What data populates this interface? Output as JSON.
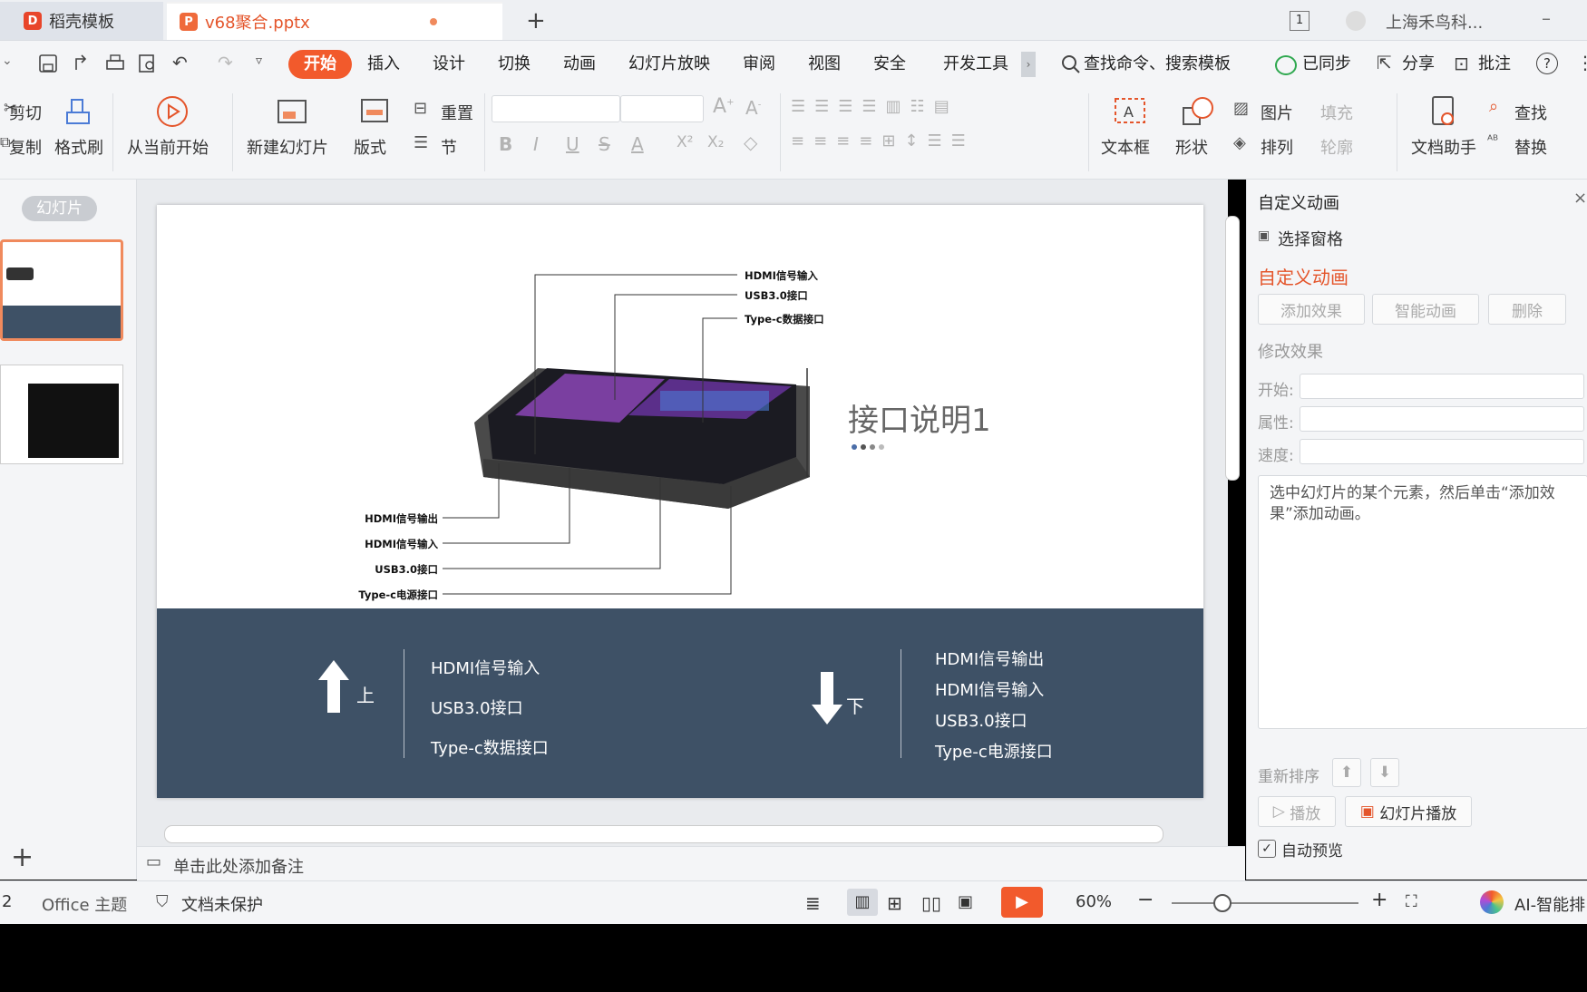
{
  "tabs": {
    "docer": "稻壳模板",
    "doc": "v68聚合.pptx",
    "page_count": "1",
    "account": "上海禾鸟科..."
  },
  "menu": {
    "start": "开始",
    "insert": "插入",
    "design": "设计",
    "transition": "切换",
    "animation": "动画",
    "slideshow": "幻灯片放映",
    "review": "审阅",
    "view": "视图",
    "security": "安全",
    "dev": "开发工具",
    "search": "查找命令、搜索模板",
    "synced": "已同步",
    "share": "分享",
    "annotate": "批注"
  },
  "ribbon": {
    "cut": "剪切",
    "copy": "复制",
    "format_painter": "格式刷",
    "from_current": "从当前开始",
    "new_slide": "新建幻灯片",
    "layout": "版式",
    "reset": "重置",
    "section": "节",
    "textbox": "文本框",
    "shape": "形状",
    "picture": "图片",
    "arrange": "排列",
    "fill": "填充",
    "outline": "轮廓",
    "doc_helper": "文档助手",
    "find": "查找",
    "replace": "替换"
  },
  "left": {
    "view_tab": "幻灯片"
  },
  "slide": {
    "title": "接口说明1",
    "callouts_top": [
      "HDMI信号输入",
      "USB3.0接口",
      "Type-c数据接口"
    ],
    "callouts_bottom": [
      "HDMI信号输出",
      "HDMI信号输入",
      "USB3.0接口",
      "Type-c电源接口"
    ],
    "up_label": "上",
    "down_label": "下",
    "up_items": [
      "HDMI信号输入",
      "USB3.0接口",
      "Type-c数据接口"
    ],
    "down_items": [
      "HDMI信号输出",
      "HDMI信号输入",
      "USB3.0接口",
      "Type-c电源接口"
    ]
  },
  "notes": "单击此处添加备注",
  "right": {
    "header": "自定义动画",
    "selection_pane": "选择窗格",
    "section_title": "自定义动画",
    "add_effect": "添加效果",
    "smart_anim": "智能动画",
    "delete": "删除",
    "modify": "修改效果",
    "start": "开始:",
    "property": "属性:",
    "speed": "速度:",
    "hint": "选中幻灯片的某个元素，然后单击“添加效果”添加动画。",
    "reorder": "重新排序",
    "play": "播放",
    "slideshow": "幻灯片播放",
    "auto_preview": "自动预览"
  },
  "status": {
    "page": "2",
    "theme": "Office 主题",
    "protect": "文档未保护",
    "zoom": "60%",
    "ai": "AI-智能排"
  },
  "colors": {
    "accent": "#f25a2c",
    "slide_band": "#3e5166"
  }
}
